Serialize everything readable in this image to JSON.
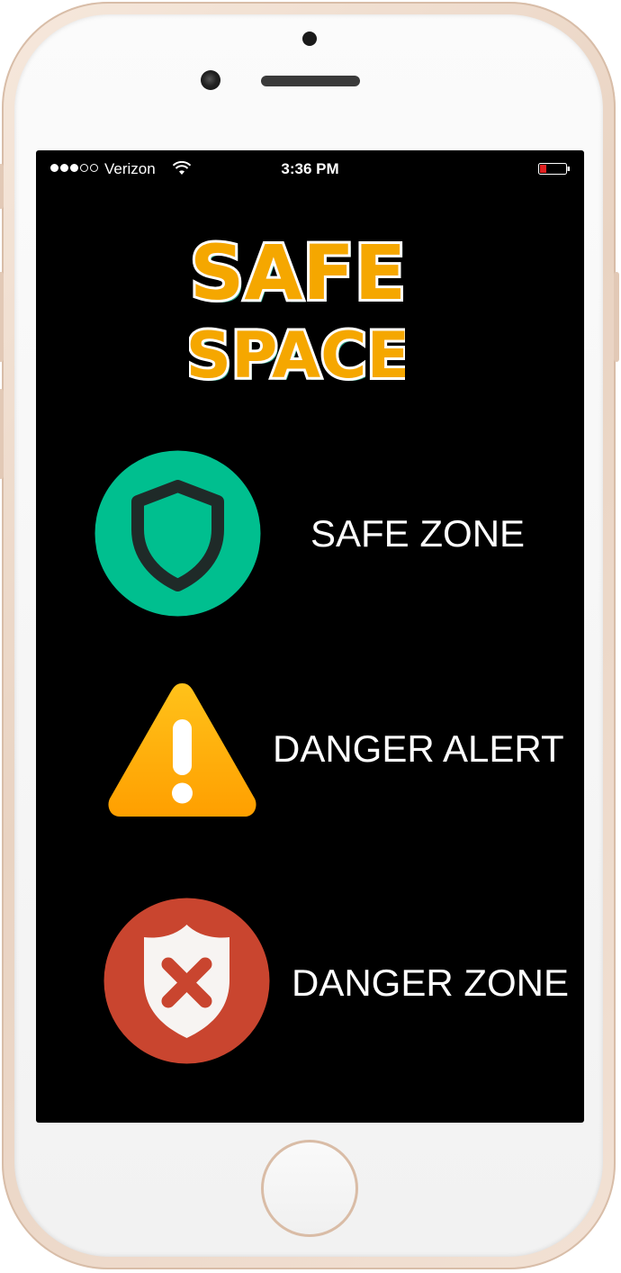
{
  "status_bar": {
    "carrier": "Verizon",
    "time": "3:36 PM",
    "signal_bars_filled": 3,
    "signal_bars_total": 5
  },
  "logo": {
    "line1": "SAFE",
    "line2": "SPACE",
    "colors": {
      "fill": "#f5a700",
      "outline": "#ffffff",
      "shadow": "#2fa58a"
    }
  },
  "menu": [
    {
      "id": "safe-zone",
      "label": "SAFE ZONE",
      "icon": "shield-check-icon",
      "color": "#00bf8f"
    },
    {
      "id": "danger-alert",
      "label": "DANGER ALERT",
      "icon": "warning-triangle-icon",
      "color": "#ffb300"
    },
    {
      "id": "danger-zone",
      "label": "DANGER ZONE",
      "icon": "shield-x-icon",
      "color": "#c9452f"
    }
  ],
  "colors": {
    "screen_bg": "#000000",
    "text": "#ffffff",
    "phone_frame": "#ecd8c8",
    "battery_level": "#e02020"
  }
}
